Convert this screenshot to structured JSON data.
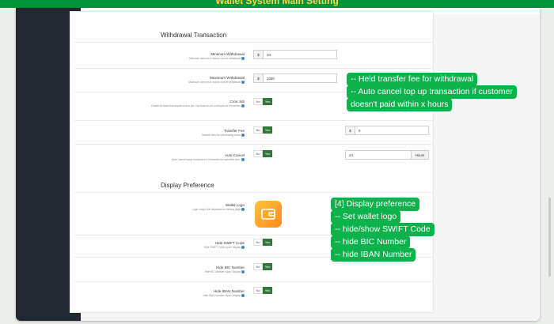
{
  "banner": {
    "title": "Wallet System Main Setting"
  },
  "withdrawal": {
    "title": "Withdrawal Transaction",
    "min": {
      "label": "Minimum Withdrawal",
      "desc": "Minimum amount of money can be withdrawal",
      "prefix": "$",
      "value": "10"
    },
    "max": {
      "label": "Maximum Withdrawal",
      "desc": "Maximum amount of money can be withdrawal",
      "prefix": "$",
      "value": "1000"
    },
    "cron": {
      "label": "Cron Job",
      "desc": "Enable all tasks that require a cron job. You have to set a cron job on the server.",
      "no": "No",
      "yes": "Yes"
    },
    "fee": {
      "label": "Transfer Fee",
      "desc": "Transfer fees for withdrawing funds",
      "no": "No",
      "yes": "Yes",
      "prefix": "$",
      "value": "0"
    },
    "cancel": {
      "label": "Auto Cancel",
      "desc": "Auto Cancel topup transaction if it exceeds the specified time.",
      "no": "No",
      "yes": "Yes",
      "value": "24",
      "suffix": "Hours"
    }
  },
  "display": {
    "title": "Display Preference",
    "logo": {
      "label": "Wallet Logo",
      "desc": "Logo image that displayed on catalog page"
    },
    "swift": {
      "label": "Hide SWIFT Code",
      "desc": "Hide SWIFT Code input / display",
      "no": "No",
      "yes": "Yes"
    },
    "bic": {
      "label": "Hide BIC Number",
      "desc": "Hide BIC Number input / display",
      "no": "No",
      "yes": "Yes"
    },
    "iban": {
      "label": "Hide IBAN Number",
      "desc": "Hide IBAN Number input / display",
      "no": "No",
      "yes": "Yes"
    }
  },
  "callouts": {
    "withdrawal": [
      "-- Held transfer fee for withdrawal",
      "-- Auto cancel top up transaction if customer",
      "doesn't paid within x hours"
    ],
    "display": [
      "[4] Display preference",
      "-- Set wallet logo",
      "-- hide/show SWIFT Code",
      "-- hide BIC Number",
      "-- hide IBAN Number"
    ]
  },
  "colors": {
    "banner": "#00953a",
    "callout": "#0db24c",
    "toggle_on": "#2f7a3a",
    "sidebar": "#212830"
  }
}
